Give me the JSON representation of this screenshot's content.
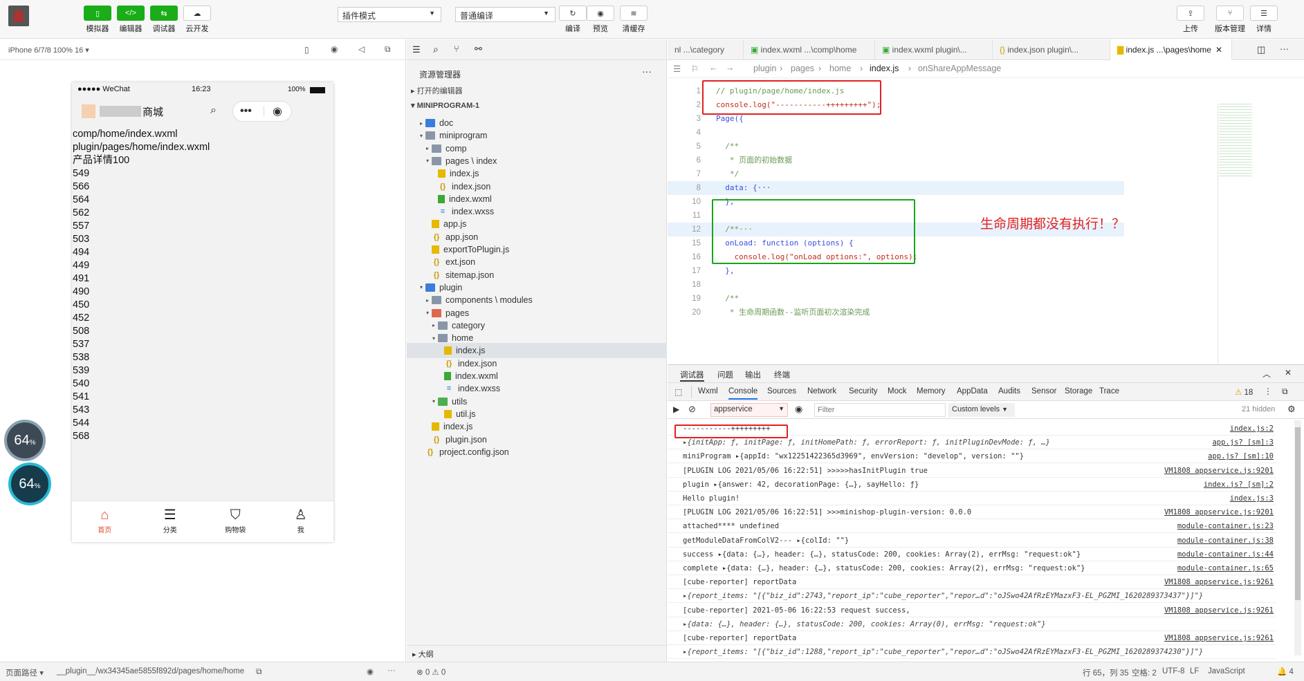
{
  "toolbar": {
    "left_buttons": [
      {
        "label": "模拟器"
      },
      {
        "label": "编辑器"
      },
      {
        "label": "调试器"
      },
      {
        "label": "云开发"
      }
    ],
    "mode_select": "插件模式",
    "compile_select": "普通编译",
    "mid_buttons": [
      {
        "label": "编译"
      },
      {
        "label": "预览"
      },
      {
        "label": "清缓存"
      }
    ],
    "right_buttons": [
      {
        "label": "上传"
      },
      {
        "label": "版本管理"
      },
      {
        "label": "详情"
      }
    ]
  },
  "simulator": {
    "device": "iPhone 6/7/8 100% 16 ▾",
    "status": {
      "carrier": "●●●●● WeChat",
      "time": "16:23",
      "battery": "100%"
    },
    "nav_title": "商城",
    "content_lines": [
      "comp/home/index.wxml",
      "plugin/pages/home/index.wxml",
      "产品详情100",
      "549",
      "566",
      "564",
      "562",
      "557",
      "503",
      "494",
      "449",
      "491",
      "490",
      "450",
      "452",
      "508",
      "537",
      "538",
      "539",
      "540",
      "541",
      "543",
      "544",
      "568"
    ],
    "tabs": [
      {
        "label": "首页"
      },
      {
        "label": "分类"
      },
      {
        "label": "购物袋"
      },
      {
        "label": "我"
      }
    ],
    "gauge1": "64",
    "gauge2": "64",
    "gauge_unit": "%"
  },
  "explorer": {
    "title": "资源管理器",
    "open_editors": "打开的编辑器",
    "project": "MINIPROGRAM-1",
    "outline": "大纲",
    "tree": [
      {
        "label": "doc",
        "type": "folder-blue",
        "depth": 1,
        "arrow": "▸"
      },
      {
        "label": "miniprogram",
        "type": "folder",
        "depth": 1,
        "arrow": "▾"
      },
      {
        "label": "comp",
        "type": "folder",
        "depth": 2,
        "arrow": "▸"
      },
      {
        "label": "pages \\ index",
        "type": "folder",
        "depth": 2,
        "arrow": "▾"
      },
      {
        "label": "index.js",
        "type": "js",
        "depth": 3,
        "arrow": ""
      },
      {
        "label": "index.json",
        "type": "json",
        "depth": 3,
        "arrow": ""
      },
      {
        "label": "index.wxml",
        "type": "wxml",
        "depth": 3,
        "arrow": ""
      },
      {
        "label": "index.wxss",
        "type": "wxss",
        "depth": 3,
        "arrow": ""
      },
      {
        "label": "app.js",
        "type": "js",
        "depth": 2,
        "arrow": ""
      },
      {
        "label": "app.json",
        "type": "json",
        "depth": 2,
        "arrow": ""
      },
      {
        "label": "exportToPlugin.js",
        "type": "js",
        "depth": 2,
        "arrow": ""
      },
      {
        "label": "ext.json",
        "type": "json",
        "depth": 2,
        "arrow": ""
      },
      {
        "label": "sitemap.json",
        "type": "json",
        "depth": 2,
        "arrow": ""
      },
      {
        "label": "plugin",
        "type": "folder-blue",
        "depth": 1,
        "arrow": "▾"
      },
      {
        "label": "components \\ modules",
        "type": "folder",
        "depth": 2,
        "arrow": "▸"
      },
      {
        "label": "pages",
        "type": "folder-red",
        "depth": 2,
        "arrow": "▾"
      },
      {
        "label": "category",
        "type": "folder",
        "depth": 3,
        "arrow": "▸"
      },
      {
        "label": "home",
        "type": "folder",
        "depth": 3,
        "arrow": "▾"
      },
      {
        "label": "index.js",
        "type": "js",
        "depth": 4,
        "arrow": "",
        "selected": true
      },
      {
        "label": "index.json",
        "type": "json",
        "depth": 4,
        "arrow": ""
      },
      {
        "label": "index.wxml",
        "type": "wxml",
        "depth": 4,
        "arrow": ""
      },
      {
        "label": "index.wxss",
        "type": "wxss",
        "depth": 4,
        "arrow": ""
      },
      {
        "label": "utils",
        "type": "folder-green",
        "depth": 3,
        "arrow": "▾"
      },
      {
        "label": "util.js",
        "type": "js",
        "depth": 4,
        "arrow": ""
      },
      {
        "label": "index.js",
        "type": "js",
        "depth": 2,
        "arrow": ""
      },
      {
        "label": "plugin.json",
        "type": "json",
        "depth": 2,
        "arrow": ""
      },
      {
        "label": "project.config.json",
        "type": "json",
        "depth": 1,
        "arrow": ""
      }
    ]
  },
  "editor": {
    "tabs": [
      {
        "label": "nl ...\\category"
      },
      {
        "label": "index.wxml ...\\comp\\home"
      },
      {
        "label": "index.wxml plugin\\..."
      },
      {
        "label": "index.json plugin\\..."
      },
      {
        "label": "index.js ...\\pages\\home",
        "active": true
      }
    ],
    "breadcrumb": [
      "plugin",
      "pages",
      "home",
      "index.js",
      "onShareAppMessage"
    ],
    "lines": [
      {
        "n": "1",
        "text": "// plugin/page/home/index.js"
      },
      {
        "n": "2",
        "text": "console.log(\"-----------+++++++++\");"
      },
      {
        "n": "3",
        "text": "Page({"
      },
      {
        "n": "4",
        "text": ""
      },
      {
        "n": "5",
        "text": "  /**"
      },
      {
        "n": "6",
        "text": "   * 页面的初始数据"
      },
      {
        "n": "7",
        "text": "   */"
      },
      {
        "n": "8",
        "text": "  data: {···"
      },
      {
        "n": "10",
        "text": "  },"
      },
      {
        "n": "11",
        "text": ""
      },
      {
        "n": "12",
        "text": "  /**···"
      },
      {
        "n": "15",
        "text": "  onLoad: function (options) {"
      },
      {
        "n": "16",
        "text": "    console.log(\"onLoad options:\", options);"
      },
      {
        "n": "17",
        "text": "  },"
      },
      {
        "n": "18",
        "text": ""
      },
      {
        "n": "19",
        "text": "  /**"
      },
      {
        "n": "20",
        "text": "   * 生命周期函数--监听页面初次渲染完成"
      }
    ],
    "annotation": "生命周期都没有执行！？"
  },
  "console": {
    "panel_tabs": [
      "调试器",
      "问题",
      "输出",
      "终端"
    ],
    "devtools_tabs": [
      "Wxml",
      "Console",
      "Sources",
      "Network",
      "Security",
      "Mock",
      "Memory",
      "AppData",
      "Audits",
      "Sensor",
      "Storage",
      "Trace"
    ],
    "warn_count": "18",
    "context": "appservice",
    "filter_placeholder": "Filter",
    "levels": "Custom levels",
    "hidden": "21 hidden",
    "rows": [
      {
        "msg": "-----------+++++++++",
        "src": "index.js:2"
      },
      {
        "msg": "▸{initApp: ƒ, initPage: ƒ, initHomePath: ƒ, errorReport: ƒ, initPluginDevMode: ƒ, …}",
        "src": "app.js? [sm]:3"
      },
      {
        "msg": "miniProgram ▸{appId: \"wx12251422365d3969\", envVersion: \"develop\", version: \"\"}",
        "src": "app.js? [sm]:10"
      },
      {
        "msg": "[PLUGIN LOG  2021/05/06 16:22:51] >>>>>hasInitPlugin true",
        "src": "VM1808 appservice.js:9201"
      },
      {
        "msg": "plugin ▸{answer: 42, decorationPage: {…}, sayHello: ƒ}",
        "src": "index.js? [sm]:2"
      },
      {
        "msg": "Hello plugin!",
        "src": "index.js:3"
      },
      {
        "msg": "[PLUGIN LOG  2021/05/06 16:22:51]  >>>minishop-plugin-version: 0.0.0",
        "src": "VM1808 appservice.js:9201"
      },
      {
        "msg": "attached**** undefined",
        "src": "module-container.js:23"
      },
      {
        "msg": "getModuleDataFromColV2--- ▸{colId: \"\"}",
        "src": "module-container.js:38"
      },
      {
        "msg": "success ▸{data: {…}, header: {…}, statusCode: 200, cookies: Array(2), errMsg: \"request:ok\"}",
        "src": "module-container.js:44"
      },
      {
        "msg": "complete ▸{data: {…}, header: {…}, statusCode: 200, cookies: Array(2), errMsg: \"request:ok\"}",
        "src": "module-container.js:65"
      },
      {
        "msg": "[cube-reporter] reportData",
        "src": "VM1808 appservice.js:9261"
      },
      {
        "msg": "▸{report_items: \"[{\"biz_id\":2743,\"report_ip\":\"cube_reporter\",\"repor…d\":\"oJSwo42AfRzEYMazxF3-EL_PGZMI_1620289373437\"}]\"}",
        "src": ""
      },
      {
        "msg": "[cube-reporter] 2021-05-06 16:22:53 request success,",
        "src": "VM1808 appservice.js:9261"
      },
      {
        "msg": "▸{data: {…}, header: {…}, statusCode: 200, cookies: Array(0), errMsg: \"request:ok\"}",
        "src": ""
      },
      {
        "msg": "[cube-reporter] reportData",
        "src": "VM1808 appservice.js:9261"
      },
      {
        "msg": "▸{report_items: \"[{\"biz_id\":1288,\"report_ip\":\"cube_reporter\",\"repor…d\":\"oJSwo42AfRzEYMazxF3-EL_PGZMI_1620289374230\"}]\"}",
        "src": ""
      }
    ]
  },
  "statusbar": {
    "path_label": "页面路径 ▾",
    "path": "__plugin__/wx34345ae5855f892d/pages/home/home",
    "problems": "⊗ 0 ⚠ 0",
    "cursor": "行 65，列 35",
    "spaces": "空格: 2",
    "encoding": "UTF-8",
    "eol": "LF",
    "language": "JavaScript",
    "bell": "🔔 4"
  }
}
